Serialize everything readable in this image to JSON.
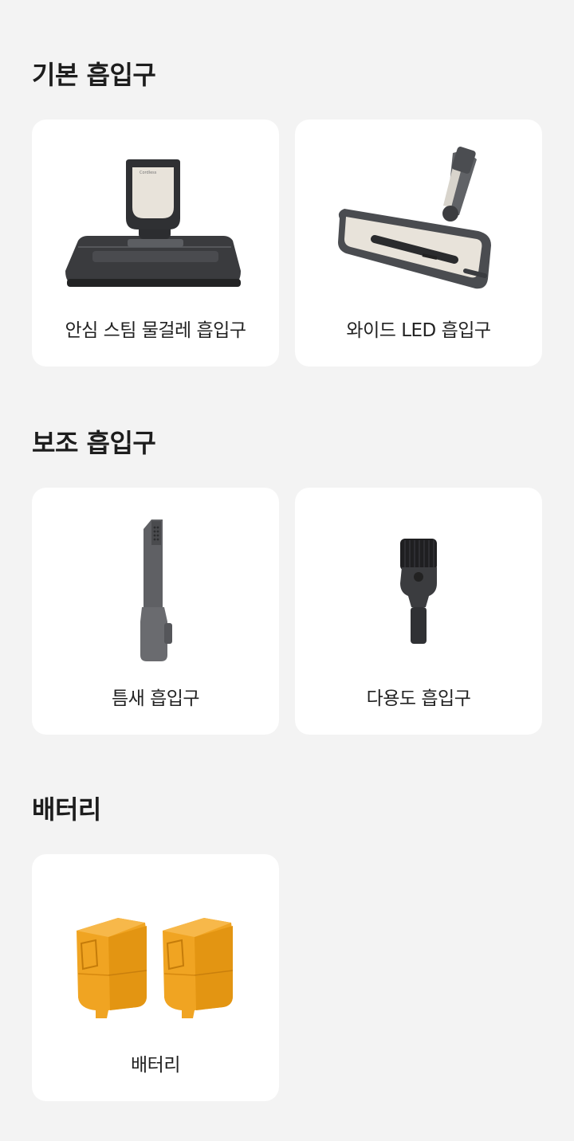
{
  "sections": [
    {
      "title": "기본 흡입구",
      "items": [
        {
          "label": "안심 스팀 물걸레 흡입구",
          "icon": "steam-mop-nozzle-icon"
        },
        {
          "label": "와이드 LED 흡입구",
          "icon": "wide-led-nozzle-icon"
        }
      ]
    },
    {
      "title": "보조 흡입구",
      "items": [
        {
          "label": "틈새 흡입구",
          "icon": "crevice-tool-icon"
        },
        {
          "label": "다용도 흡입구",
          "icon": "multipurpose-brush-icon"
        }
      ]
    },
    {
      "title": "배터리",
      "items": [
        {
          "label": "배터리",
          "icon": "battery-pack-icon"
        }
      ]
    }
  ],
  "colors": {
    "background": "#f3f3f3",
    "card": "#ffffff",
    "battery": "#f2a623",
    "tool_gray": "#6e6e72",
    "nozzle_body": "#e9e4dc"
  }
}
